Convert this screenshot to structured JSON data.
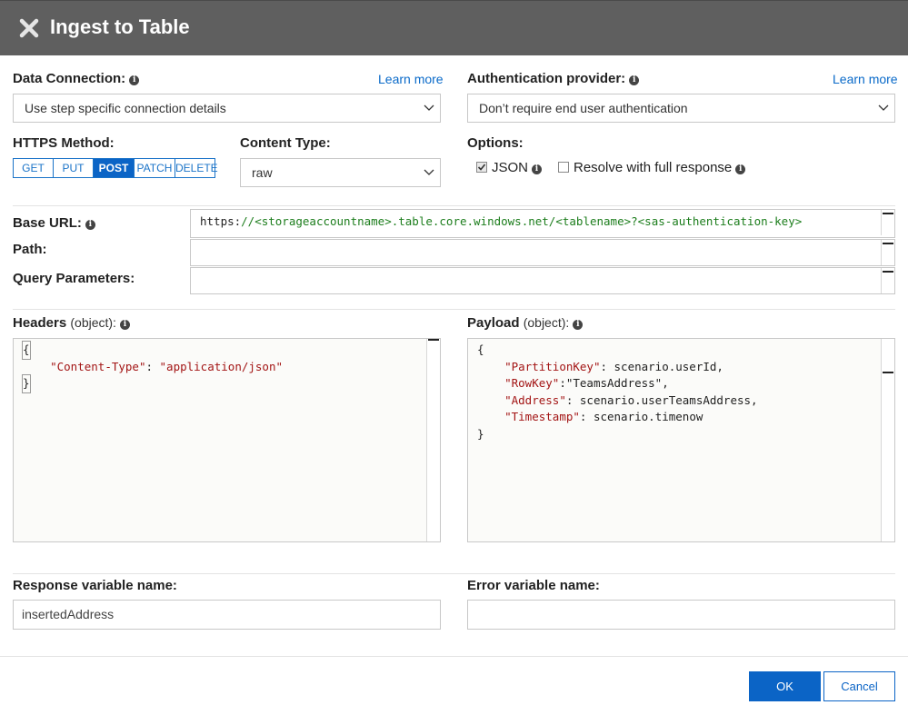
{
  "dialog": {
    "title": "Ingest to Table"
  },
  "data_connection": {
    "label": "Data Connection:",
    "learn_more": "Learn more",
    "selected": "Use step specific connection details"
  },
  "auth_provider": {
    "label": "Authentication provider:",
    "learn_more": "Learn more",
    "selected": "Don’t require end user authentication"
  },
  "https_method": {
    "label": "HTTPS Method:",
    "options": [
      "GET",
      "PUT",
      "POST",
      "PATCH",
      "DELETE"
    ],
    "selected": "POST"
  },
  "content_type": {
    "label": "Content Type:",
    "selected": "raw"
  },
  "options": {
    "label": "Options:",
    "json_label": "JSON",
    "json_checked": true,
    "resolve_label": "Resolve with full response",
    "resolve_checked": false
  },
  "base_url": {
    "label": "Base URL:",
    "scheme": "https:",
    "rest": "//<storageaccountname>.table.core.windows.net/<tablename>?<sas-authentication-key>"
  },
  "path": {
    "label": "Path:",
    "value": ""
  },
  "query_params": {
    "label": "Query Parameters:",
    "value": ""
  },
  "headers": {
    "label": "Headers",
    "type": "(object):",
    "open": "{",
    "key": "\"Content-Type\"",
    "sep": ": ",
    "value": "\"application/json\"",
    "close": "}"
  },
  "payload": {
    "label": "Payload",
    "type": "(object):",
    "open": "{",
    "lines": [
      {
        "key": "\"PartitionKey\"",
        "rest": ": scenario.userId,"
      },
      {
        "key": "\"RowKey\"",
        "rest": ":\"TeamsAddress\","
      },
      {
        "key": "\"Address\"",
        "rest": ": scenario.userTeamsAddress,"
      },
      {
        "key": "\"Timestamp\"",
        "rest": ": scenario.timenow"
      }
    ],
    "close": "}"
  },
  "response_var": {
    "label": "Response variable name:",
    "value": "insertedAddress"
  },
  "error_var": {
    "label": "Error variable name:",
    "value": ""
  },
  "buttons": {
    "ok": "OK",
    "cancel": "Cancel"
  },
  "colors": {
    "titlebar": "#5f5f5f",
    "accent": "#0b64c6",
    "link": "#0a6ac9",
    "code_key": "#a31515",
    "url_green": "#1c7d1c"
  }
}
